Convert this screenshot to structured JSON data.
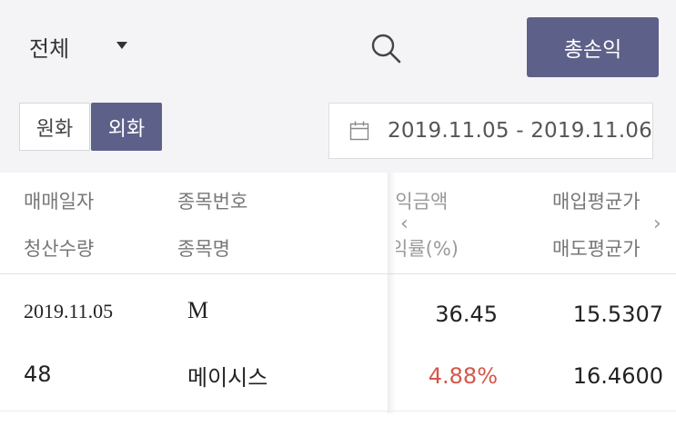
{
  "filter": {
    "label": "전체"
  },
  "buttons": {
    "total_pnl": "총손익"
  },
  "currency_tabs": {
    "krw": "원화",
    "fx": "외화",
    "selected": "외화"
  },
  "date_range": {
    "text": "2019.11.05 - 2019.11.06"
  },
  "columns": {
    "trade_date": "매매일자",
    "settle_qty": "청산수량",
    "stock_code": "종목번호",
    "stock_name": "종목명",
    "pnl_amount": "손익금액",
    "return_rate": "익률(%)",
    "avg_buy": "매입평균가",
    "avg_sell": "매도평균가"
  },
  "rows": [
    {
      "trade_date": "2019.11.05",
      "settle_qty": "48",
      "stock_code": "M",
      "stock_name": "메이시스",
      "pnl_amount": "36.45",
      "return_rate": "4.88%",
      "avg_buy": "15.5307",
      "avg_sell": "16.4600"
    }
  ],
  "colors": {
    "accent": "#5d6189",
    "negative_or_gain": "#d4574a"
  }
}
